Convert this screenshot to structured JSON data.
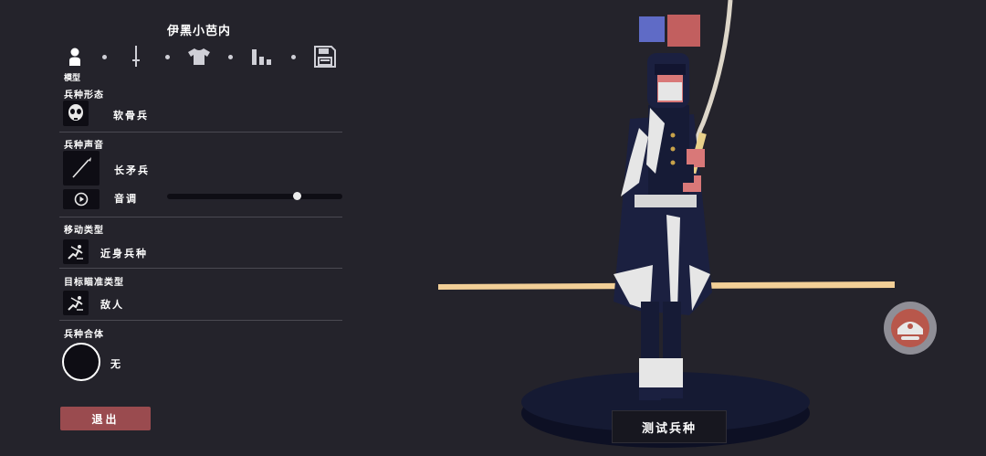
{
  "editor": {
    "unit_name": "伊黑小芭内",
    "tabs": [
      {
        "icon": "person-icon"
      },
      {
        "icon": "sword-icon"
      },
      {
        "icon": "shirt-icon"
      },
      {
        "icon": "bar-chart-icon"
      },
      {
        "icon": "save-icon"
      }
    ],
    "active_tab_label": "模型",
    "unit_form": {
      "label": "兵种形态",
      "value": "软骨兵",
      "icon": "skull-mask-icon"
    },
    "unit_voice": {
      "label": "兵种声音",
      "value": "长矛兵",
      "icon": "spear-icon"
    },
    "pitch": {
      "label": "音调",
      "level": 0.74,
      "icon": "play-icon"
    },
    "movement_type": {
      "label": "移动类型",
      "value": "近身兵种",
      "icon": "melee-run-icon"
    },
    "targeting_type": {
      "label": "目标瞄准类型",
      "value": "敌人",
      "icon": "target-enemy-icon"
    },
    "unit_combine": {
      "label": "兵种合体",
      "value": "无",
      "icon": "empty-circle-icon"
    },
    "exit_label": "退出"
  },
  "preview": {
    "team_colors": [
      "#5f6bc6",
      "#c25f5f"
    ],
    "test_button_label": "测试兵种",
    "ground_line_color": "#f2cf97",
    "platform_color": "#141a33"
  },
  "colors": {
    "background": "#24232b",
    "exit_button": "#9a4b4f",
    "icon_box": "#0e0d14"
  }
}
